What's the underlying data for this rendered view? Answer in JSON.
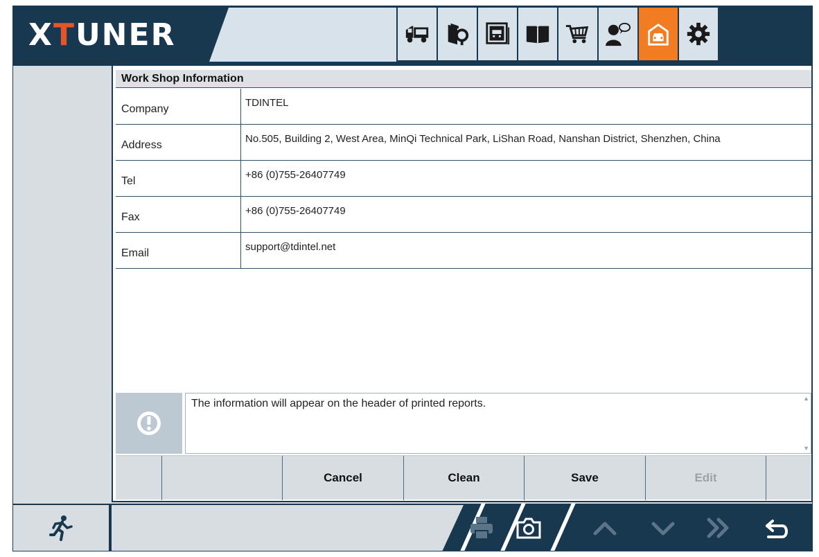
{
  "app": {
    "brand_left": "X",
    "brand_mark": "T",
    "brand_right": "UNER"
  },
  "toolbar": {
    "icons": [
      "truck-icon",
      "book-search-icon",
      "vehicle-window-icon",
      "manual-book-icon",
      "shopping-cart-icon",
      "user-chat-icon",
      "garage-icon",
      "gear-icon"
    ],
    "active": "garage-icon",
    "active_color": "#f27c21"
  },
  "workshop": {
    "title": "Work Shop Information",
    "fields": [
      {
        "label": "Company",
        "value": "TDINTEL"
      },
      {
        "label": "Address",
        "value": "No.505, Building 2, West Area, MinQi Technical Park, LiShan Road, Nanshan District, Shenzhen, China"
      },
      {
        "label": "Tel",
        "value": "+86 (0)755-26407749"
      },
      {
        "label": "Fax",
        "value": "+86 (0)755-26407749"
      },
      {
        "label": "Email",
        "value": "support@tdintel.net"
      }
    ]
  },
  "notice": {
    "text": "The information will appear on the header of printed reports."
  },
  "buttons": {
    "cancel": "Cancel",
    "clean": "Clean",
    "save": "Save",
    "edit": "Edit"
  },
  "bottombar": {
    "icons": [
      "exit-run-icon",
      "print-icon",
      "camera-icon",
      "chevron-up-icon",
      "chevron-down-icon",
      "fast-forward-icon",
      "back-icon"
    ]
  },
  "colors": {
    "dark_navy": "#17384f",
    "panel_gray": "#d8dde2",
    "accent_orange": "#f27c21"
  }
}
